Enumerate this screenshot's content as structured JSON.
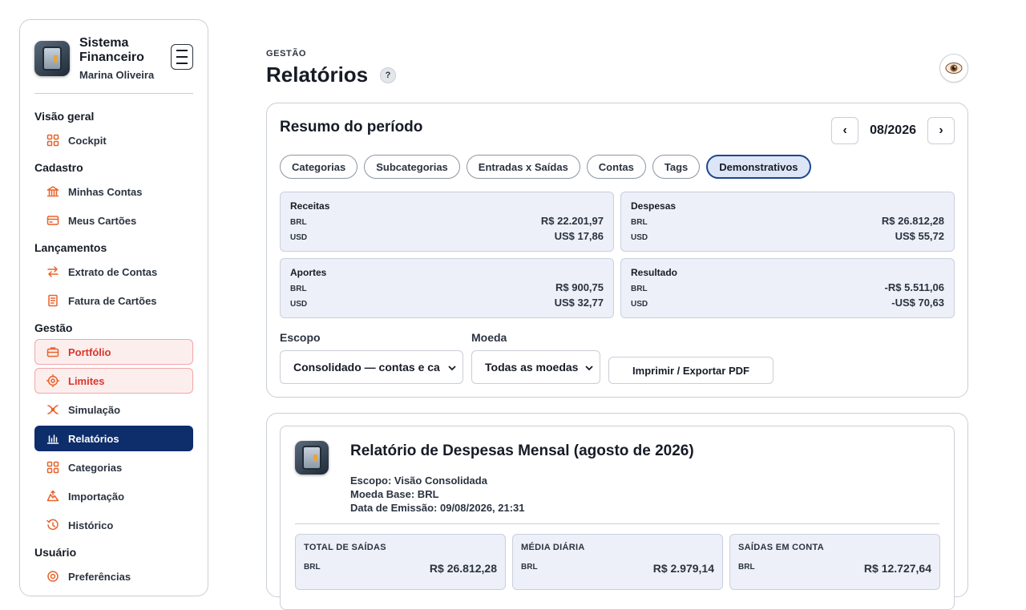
{
  "brand": {
    "title": "Sistema Financeiro",
    "user": "Marina Oliveira"
  },
  "sidebar": {
    "sections": [
      {
        "title": "Visão geral",
        "items": [
          {
            "label": "Cockpit",
            "icon": "grid-icon"
          }
        ]
      },
      {
        "title": "Cadastro",
        "items": [
          {
            "label": "Minhas Contas",
            "icon": "bank-icon"
          },
          {
            "label": "Meus Cartões",
            "icon": "credit-card-icon"
          }
        ]
      },
      {
        "title": "Lançamentos",
        "items": [
          {
            "label": "Extrato de Contas",
            "icon": "transfer-icon"
          },
          {
            "label": "Fatura de Cartões",
            "icon": "invoice-icon"
          }
        ]
      },
      {
        "title": "Gestão",
        "items": [
          {
            "label": "Portfólio",
            "icon": "briefcase-icon",
            "state": "warn"
          },
          {
            "label": "Limites",
            "icon": "target-icon",
            "state": "warn"
          },
          {
            "label": "Simulação",
            "icon": "simulation-icon"
          },
          {
            "label": "Relatórios",
            "icon": "bar-chart-icon",
            "state": "active"
          },
          {
            "label": "Categorias",
            "icon": "grid-icon"
          },
          {
            "label": "Importação",
            "icon": "upload-icon"
          },
          {
            "label": "Histórico",
            "icon": "history-icon"
          }
        ]
      },
      {
        "title": "Usuário",
        "items": [
          {
            "label": "Preferências",
            "icon": "settings-icon"
          }
        ]
      }
    ]
  },
  "header": {
    "eyebrow": "GESTÃO",
    "title": "Relatórios",
    "help": "?"
  },
  "summary": {
    "title": "Resumo do período",
    "period": "08/2026",
    "prev": "‹",
    "next": "›",
    "tabs": [
      "Categorias",
      "Subcategorias",
      "Entradas x Saídas",
      "Contas",
      "Tags",
      "Demonstrativos"
    ],
    "active_tab": "Demonstrativos",
    "stats": [
      {
        "label": "Receitas",
        "rows": [
          {
            "cur": "BRL",
            "val": "R$ 22.201,97"
          },
          {
            "cur": "USD",
            "val": "US$ 17,86"
          }
        ]
      },
      {
        "label": "Despesas",
        "rows": [
          {
            "cur": "BRL",
            "val": "R$ 26.812,28"
          },
          {
            "cur": "USD",
            "val": "US$ 55,72"
          }
        ]
      },
      {
        "label": "Aportes",
        "rows": [
          {
            "cur": "BRL",
            "val": "R$ 900,75"
          },
          {
            "cur": "USD",
            "val": "US$ 32,77"
          }
        ]
      },
      {
        "label": "Resultado",
        "rows": [
          {
            "cur": "BRL",
            "val": "-R$ 5.511,06"
          },
          {
            "cur": "USD",
            "val": "-US$ 70,63"
          }
        ]
      }
    ],
    "scope_label": "Escopo",
    "scope_value": "Consolidado — contas e ca",
    "currency_label": "Moeda",
    "currency_value": "Todas as moedas",
    "print_label": "Imprimir / Exportar PDF"
  },
  "report": {
    "title": "Relatório de Despesas Mensal (agosto de 2026)",
    "scope": "Escopo: Visão Consolidada",
    "base_currency": "Moeda Base: BRL",
    "issued": "Data de Emissão: 09/08/2026, 21:31",
    "cards": [
      {
        "label": "TOTAL DE SAÍDAS",
        "cur": "BRL",
        "val": "R$ 26.812,28"
      },
      {
        "label": "MÉDIA DIÁRIA",
        "cur": "BRL",
        "val": "R$ 2.979,14"
      },
      {
        "label": "SAÍDAS EM CONTA",
        "cur": "BRL",
        "val": "R$ 12.727,64"
      }
    ]
  },
  "colors": {
    "accent": "#e8622a",
    "active": "#0e2d6b",
    "warn": "#d9362b",
    "stat_bg": "#edf0f8"
  }
}
